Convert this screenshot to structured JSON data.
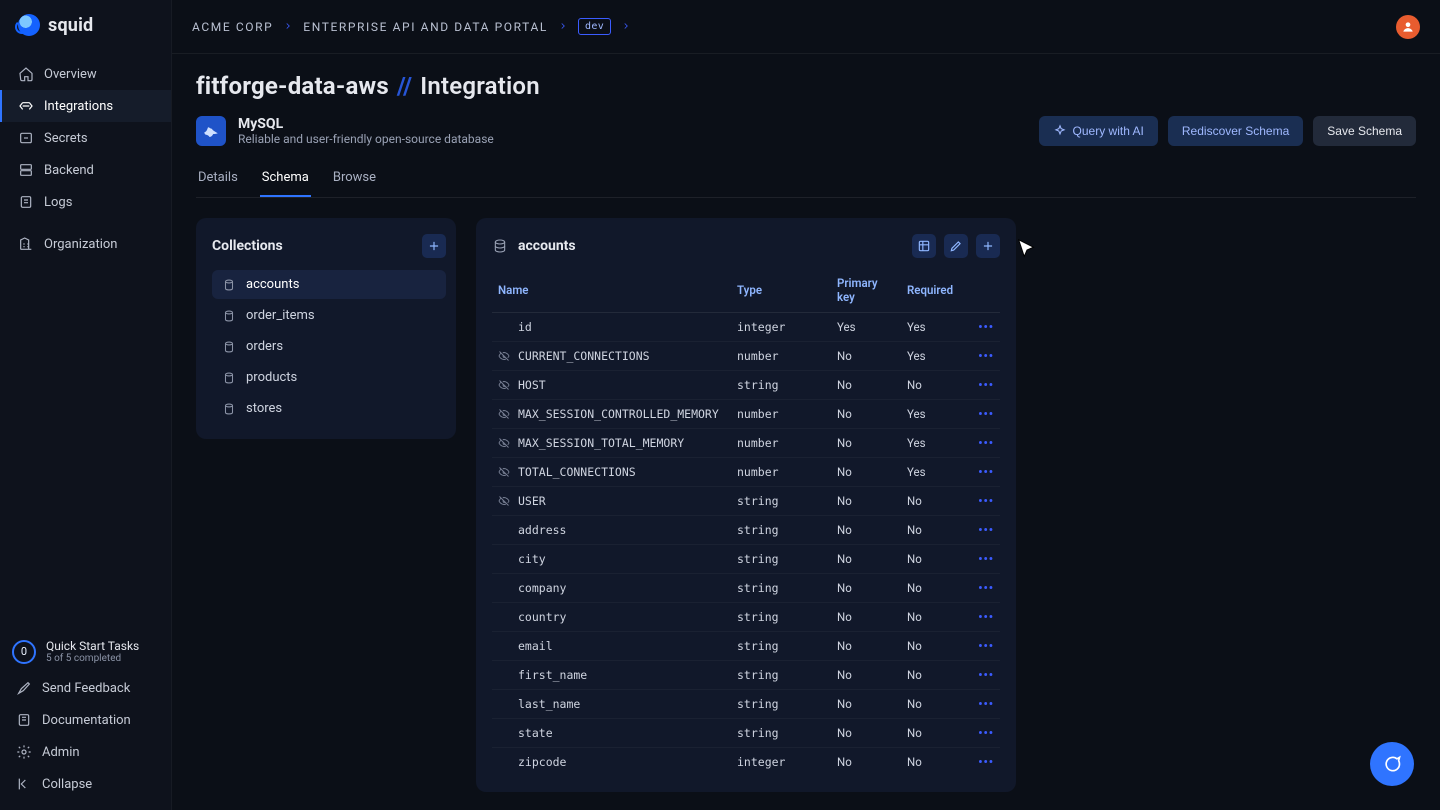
{
  "brand": "squid",
  "sidebar": {
    "items": [
      {
        "label": "Overview"
      },
      {
        "label": "Integrations"
      },
      {
        "label": "Secrets"
      },
      {
        "label": "Backend"
      },
      {
        "label": "Logs"
      },
      {
        "label": "Organization"
      }
    ]
  },
  "quickstart": {
    "count": "0",
    "title": "Quick Start Tasks",
    "sub": "5 of 5 completed"
  },
  "bottom": {
    "feedback": "Send Feedback",
    "docs": "Documentation",
    "admin": "Admin",
    "collapse": "Collapse"
  },
  "breadcrumb": {
    "org": "ACME CORP",
    "project": "ENTERPRISE API AND DATA PORTAL",
    "env": "dev"
  },
  "page": {
    "title": "fitforge-data-aws",
    "section": "Integration"
  },
  "integration": {
    "name": "MySQL",
    "desc": "Reliable and user-friendly open-source database"
  },
  "actions": {
    "query": "Query with AI",
    "rediscover": "Rediscover Schema",
    "save": "Save Schema"
  },
  "tabs": {
    "details": "Details",
    "schema": "Schema",
    "browse": "Browse"
  },
  "collections": {
    "title": "Collections",
    "items": [
      "accounts",
      "order_items",
      "orders",
      "products",
      "stores"
    ],
    "selected": "accounts"
  },
  "schema": {
    "title": "accounts",
    "columns": {
      "name": "Name",
      "type": "Type",
      "pk": "Primary key",
      "req": "Required"
    },
    "rows": [
      {
        "name": "id",
        "type": "integer",
        "pk": "Yes",
        "req": "Yes",
        "hidden": false
      },
      {
        "name": "CURRENT_CONNECTIONS",
        "type": "number",
        "pk": "No",
        "req": "Yes",
        "hidden": true
      },
      {
        "name": "HOST",
        "type": "string",
        "pk": "No",
        "req": "No",
        "hidden": true
      },
      {
        "name": "MAX_SESSION_CONTROLLED_MEMORY",
        "type": "number",
        "pk": "No",
        "req": "Yes",
        "hidden": true
      },
      {
        "name": "MAX_SESSION_TOTAL_MEMORY",
        "type": "number",
        "pk": "No",
        "req": "Yes",
        "hidden": true
      },
      {
        "name": "TOTAL_CONNECTIONS",
        "type": "number",
        "pk": "No",
        "req": "Yes",
        "hidden": true
      },
      {
        "name": "USER",
        "type": "string",
        "pk": "No",
        "req": "No",
        "hidden": true
      },
      {
        "name": "address",
        "type": "string",
        "pk": "No",
        "req": "No",
        "hidden": false
      },
      {
        "name": "city",
        "type": "string",
        "pk": "No",
        "req": "No",
        "hidden": false
      },
      {
        "name": "company",
        "type": "string",
        "pk": "No",
        "req": "No",
        "hidden": false
      },
      {
        "name": "country",
        "type": "string",
        "pk": "No",
        "req": "No",
        "hidden": false
      },
      {
        "name": "email",
        "type": "string",
        "pk": "No",
        "req": "No",
        "hidden": false
      },
      {
        "name": "first_name",
        "type": "string",
        "pk": "No",
        "req": "No",
        "hidden": false
      },
      {
        "name": "last_name",
        "type": "string",
        "pk": "No",
        "req": "No",
        "hidden": false
      },
      {
        "name": "state",
        "type": "string",
        "pk": "No",
        "req": "No",
        "hidden": false
      },
      {
        "name": "zipcode",
        "type": "integer",
        "pk": "No",
        "req": "No",
        "hidden": false
      }
    ]
  }
}
